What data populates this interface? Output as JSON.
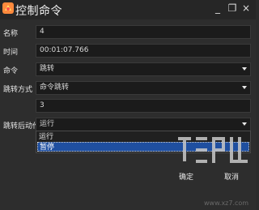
{
  "window": {
    "title": "控制命令",
    "controls": {
      "minimize": "_",
      "maximize": "❐",
      "close": "×"
    }
  },
  "form": {
    "name": {
      "label": "名称",
      "value": "4"
    },
    "time": {
      "label": "时间",
      "value": "00:01:07.766"
    },
    "command": {
      "label": "命令",
      "value": "跳转"
    },
    "jump_mode": {
      "label": "跳转方式",
      "value": "命令跳转"
    },
    "number": {
      "value": "3"
    },
    "post_jump_action": {
      "label": "跳转后动作",
      "value": "运行",
      "options": [
        "运行",
        "暂停"
      ],
      "highlighted_option": "暂停"
    }
  },
  "footer": {
    "ok": "确定",
    "cancel": "取消"
  },
  "watermark": {
    "text": "www.xz7.com"
  }
}
